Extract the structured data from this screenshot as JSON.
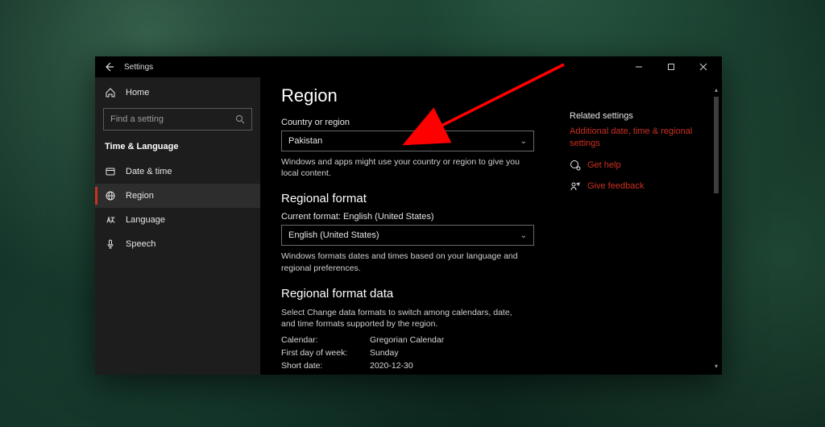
{
  "window": {
    "title": "Settings"
  },
  "sidebar": {
    "home_label": "Home",
    "search_placeholder": "Find a setting",
    "category": "Time & Language",
    "items": [
      {
        "label": "Date & time"
      },
      {
        "label": "Region"
      },
      {
        "label": "Language"
      },
      {
        "label": "Speech"
      }
    ]
  },
  "page": {
    "title": "Region",
    "country_label": "Country or region",
    "country_value": "Pakistan",
    "country_help": "Windows and apps might use your country or region to give you local content.",
    "regional_format_heading": "Regional format",
    "current_format_label": "Current format: English (United States)",
    "format_value": "English (United States)",
    "format_help": "Windows formats dates and times based on your language and regional preferences.",
    "regional_data_heading": "Regional format data",
    "regional_data_help": "Select Change data formats to switch among calendars, date, and time formats supported by the region.",
    "rows": {
      "calendar_k": "Calendar:",
      "calendar_v": "Gregorian Calendar",
      "firstday_k": "First day of week:",
      "firstday_v": "Sunday",
      "shortdate_k": "Short date:",
      "shortdate_v": "2020-12-30"
    }
  },
  "rightcol": {
    "related_heading": "Related settings",
    "related_link": "Additional date, time & regional settings",
    "get_help": "Get help",
    "give_feedback": "Give feedback"
  },
  "colors": {
    "accent": "#cc3022"
  }
}
